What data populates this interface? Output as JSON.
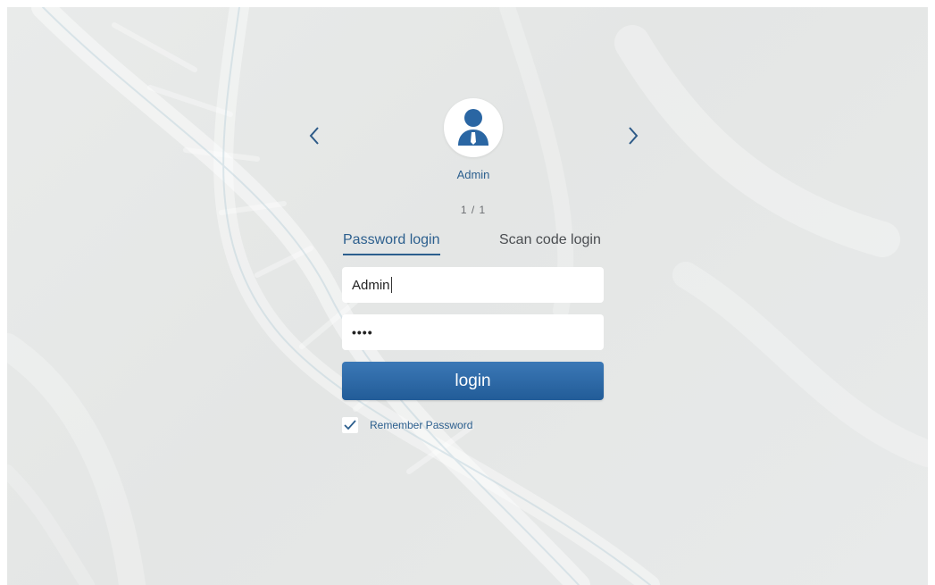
{
  "user": {
    "name": "Admin",
    "page_indicator": "1 / 1",
    "avatar_icon": "user-avatar-icon"
  },
  "navigation": {
    "prev_icon": "chevron-left-icon",
    "next_icon": "chevron-right-icon"
  },
  "tabs": [
    {
      "label": "Password login",
      "active": true
    },
    {
      "label": "Scan code login",
      "active": false
    }
  ],
  "form": {
    "username_value": "Admin",
    "password_mask": "••••",
    "login_label": "login",
    "remember": {
      "label": "Remember Password",
      "checked": true
    }
  },
  "colors": {
    "accent": "#2c5f8e",
    "button_top": "#3b78b6",
    "button_bottom": "#225c98",
    "background": "#e6e8e7"
  }
}
